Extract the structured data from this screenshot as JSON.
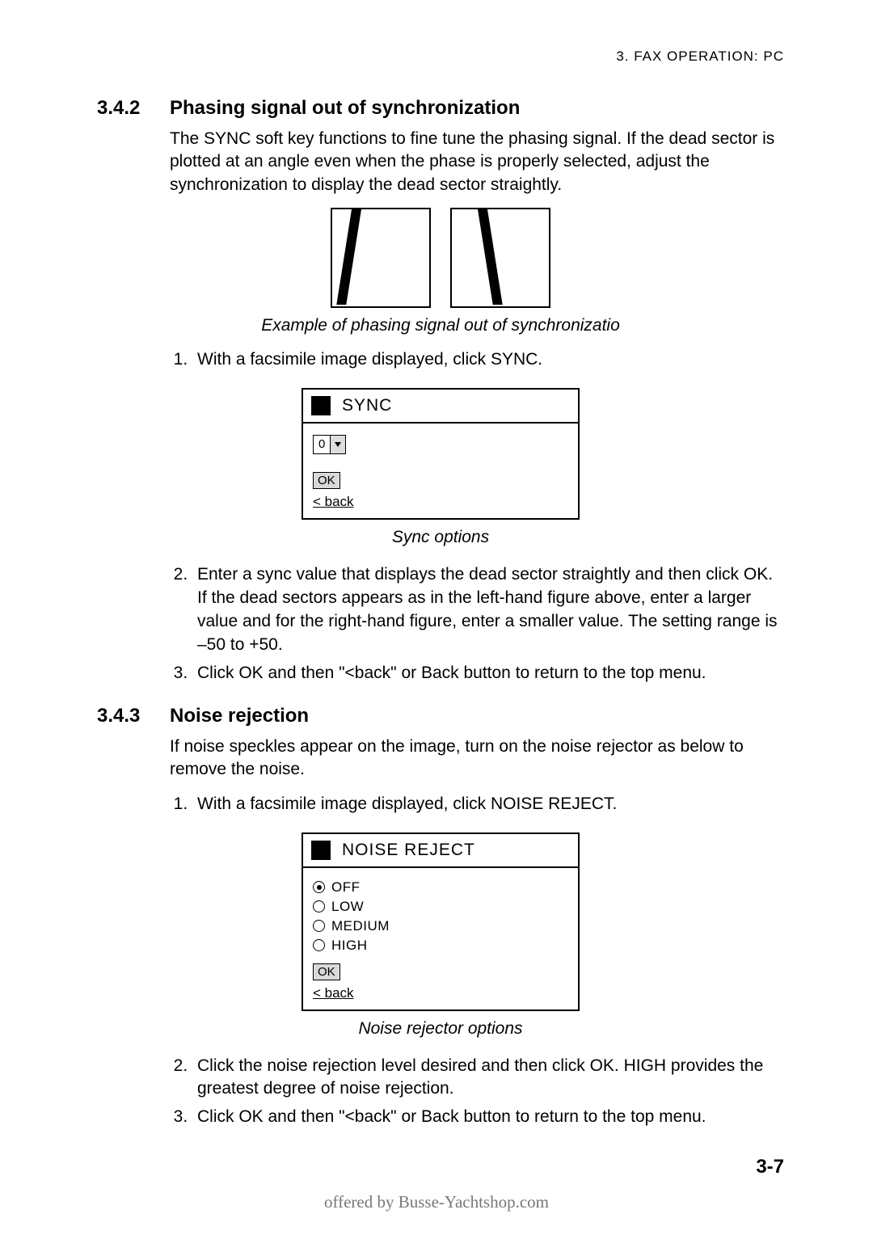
{
  "running_head": "3. FAX OPERATION: PC",
  "section1": {
    "num": "3.4.2",
    "title": "Phasing signal out of synchronization",
    "intro": "The SYNC soft key functions to fine tune the phasing signal. If the dead sector is plotted at an angle even when the phase is properly selected, adjust the synchronization to display the dead sector straightly.",
    "fig_caption": "Example of phasing signal out of synchronizatio",
    "step1": "With a facsimile image displayed, click SYNC.",
    "sync_dialog": {
      "title": "SYNC",
      "value": "0",
      "ok": "OK",
      "back": "< back"
    },
    "sync_caption": "Sync options",
    "step2": "Enter a sync value that displays the dead sector straightly and then click OK. If the dead sectors appears as in the left-hand figure above, enter a larger value and for the right-hand figure, enter a smaller value. The setting range is –50 to +50.",
    "step3": "Click OK and then \"<back\" or Back button to return to the top menu."
  },
  "section2": {
    "num": "3.4.3",
    "title": "Noise rejection",
    "intro": "If noise speckles appear on the image, turn on the noise rejector as below to remove the noise.",
    "step1": "With a facsimile image displayed, click NOISE REJECT.",
    "noise_dialog": {
      "title": "NOISE REJECT",
      "opt_off": "OFF",
      "opt_low": "LOW",
      "opt_medium": "MEDIUM",
      "opt_high": "HIGH",
      "ok": "OK",
      "back": "< back"
    },
    "noise_caption": "Noise rejector options",
    "step2": "Click the noise rejection level desired and then click OK. HIGH provides the greatest degree of noise rejection.",
    "step3": "Click OK and then \"<back\" or Back button to return to the top menu."
  },
  "page_num": "3-7",
  "footer": "offered by Busse-Yachtshop.com"
}
